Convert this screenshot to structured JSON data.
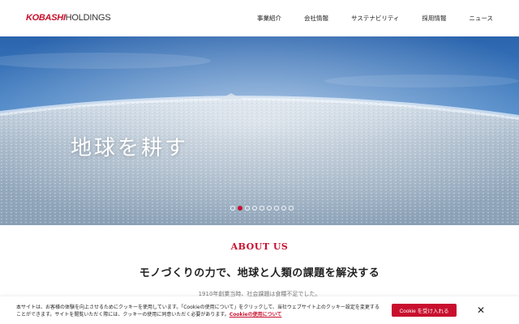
{
  "header": {
    "logo_bold": "KOBASHI",
    "logo_thin": "HOLDINGS",
    "nav": [
      {
        "label": "事業紹介"
      },
      {
        "label": "会社情報"
      },
      {
        "label": "サステナビリティ"
      },
      {
        "label": "採用情報"
      },
      {
        "label": "ニュース"
      }
    ]
  },
  "hero": {
    "title": "地球を耕す",
    "slide_count": 9,
    "active_slide": 2
  },
  "about": {
    "heading": "ABOUT US",
    "subheading": "モノづくりの力で、地球と人類の課題を解決する",
    "body": "1910年創業当時、社会課題は食糧不足でした。"
  },
  "cookie": {
    "text_before": "本サイトは、お客様の体験を向上させるためにクッキーを使用しています。「Cookieの使用について」をクリックして、当社ウェブサイト上のクッキー設定を変更することができます。サイトを閲覧いただく際には、クッキーの使用に同意いただく必要があります。",
    "link": "Cookieの使用について",
    "accept_label": "Cookie を受け入れる",
    "close_label": "✕"
  },
  "colors": {
    "brand": "#c8102e",
    "sky": "#2f6fb8",
    "earth": "#a9b9c9"
  }
}
